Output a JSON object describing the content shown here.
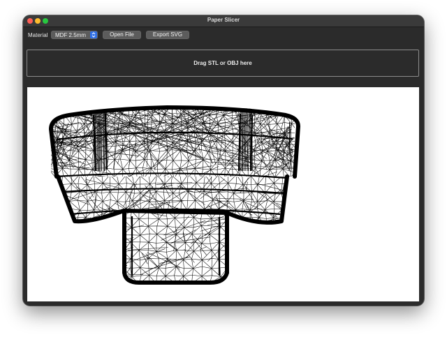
{
  "window": {
    "title": "Paper Slicer"
  },
  "toolbar": {
    "material_label": "Material",
    "material_value": "MDF 2.5mm",
    "open_file_label": "Open File",
    "export_svg_label": "Export SVG"
  },
  "dropzone": {
    "text": "Drag STL or OBJ here"
  },
  "preview": {
    "icon": "mesh-wireframe",
    "stroke_color": "#000000",
    "background_color": "#ffffff"
  }
}
